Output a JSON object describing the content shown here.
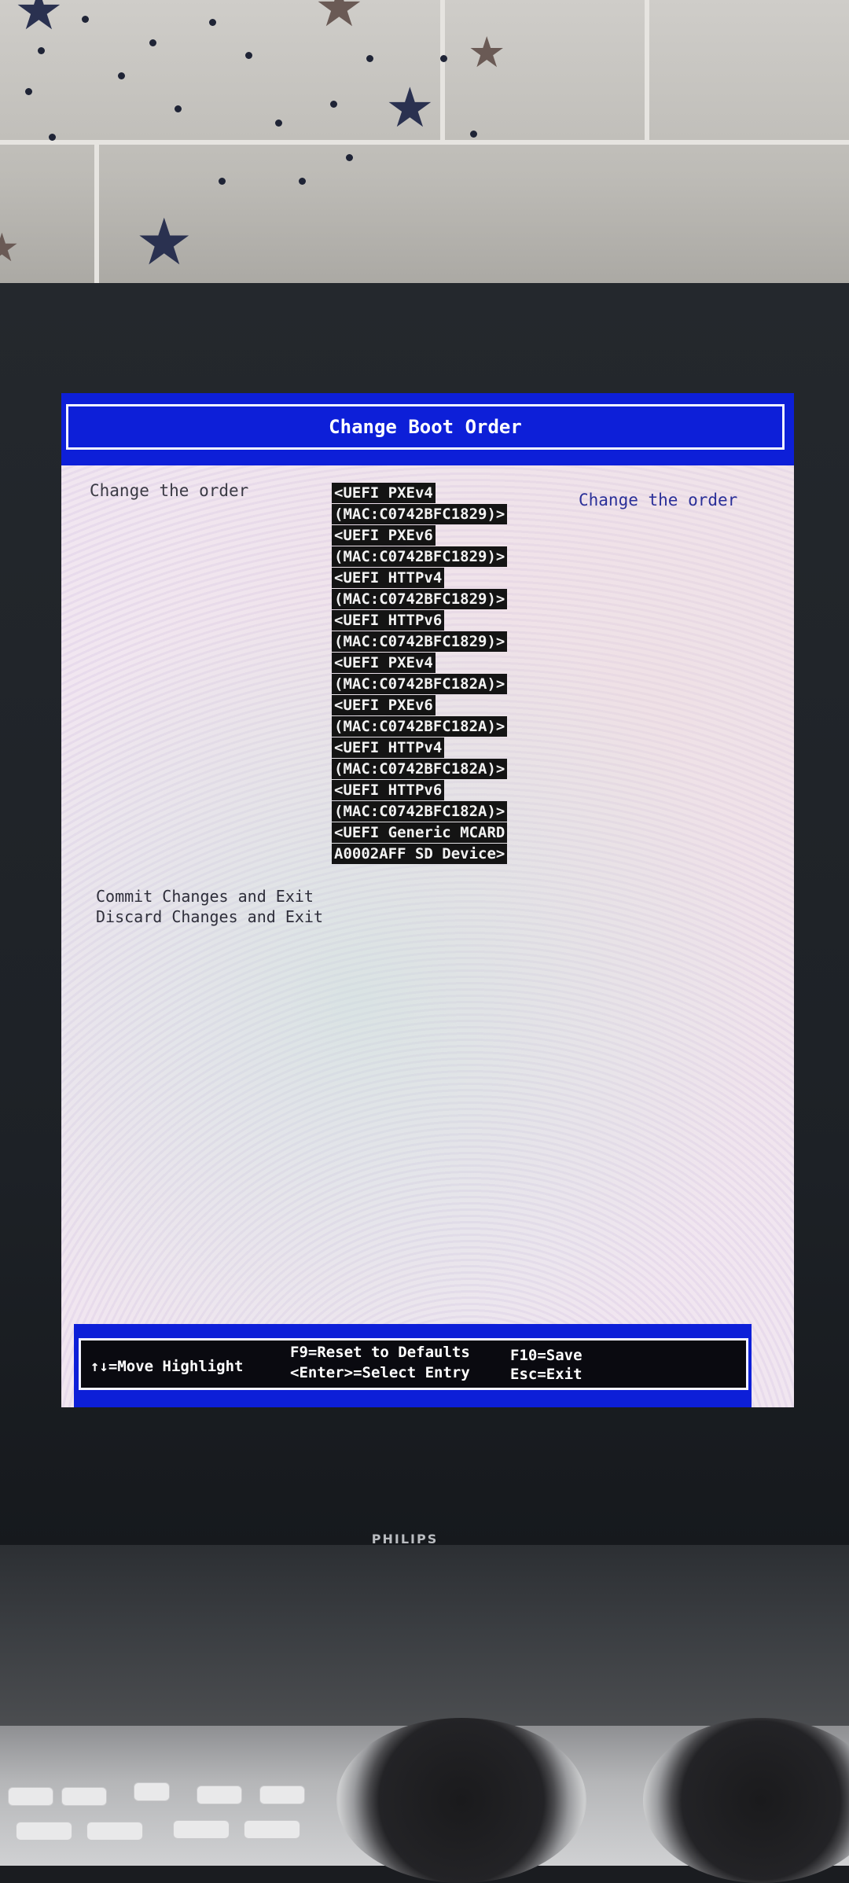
{
  "screen": {
    "title": "Change Boot Order",
    "left_label": "Change the order",
    "help_text": "Change the order",
    "boot_items": [
      {
        "line1": "<UEFI PXEv4",
        "line2": "(MAC:C0742BFC1829)>"
      },
      {
        "line1": "<UEFI PXEv6",
        "line2": "(MAC:C0742BFC1829)>"
      },
      {
        "line1": "<UEFI HTTPv4",
        "line2": "(MAC:C0742BFC1829)>"
      },
      {
        "line1": "<UEFI HTTPv6",
        "line2": "(MAC:C0742BFC1829)>"
      },
      {
        "line1": "<UEFI PXEv4",
        "line2": "(MAC:C0742BFC182A)>"
      },
      {
        "line1": "<UEFI PXEv6",
        "line2": "(MAC:C0742BFC182A)>"
      },
      {
        "line1": "<UEFI HTTPv4",
        "line2": "(MAC:C0742BFC182A)>"
      },
      {
        "line1": "<UEFI HTTPv6",
        "line2": "(MAC:C0742BFC182A)>"
      },
      {
        "line1": "<UEFI Generic MCARD",
        "line2": "A0002AFF SD Device>"
      }
    ],
    "commit": "Commit Changes and Exit",
    "discard": "Discard Changes and Exit"
  },
  "footer": {
    "move": "↑↓=Move Highlight",
    "reset": "F9=Reset to Defaults",
    "select": "<Enter>=Select Entry",
    "save": "F10=Save",
    "exit": "Esc=Exit"
  },
  "monitor": {
    "brand": "PHILIPS"
  },
  "colors": {
    "bios_blue": "#0d1fd8",
    "highlight_bg": "#141414",
    "help_text": "#2a2f98"
  }
}
